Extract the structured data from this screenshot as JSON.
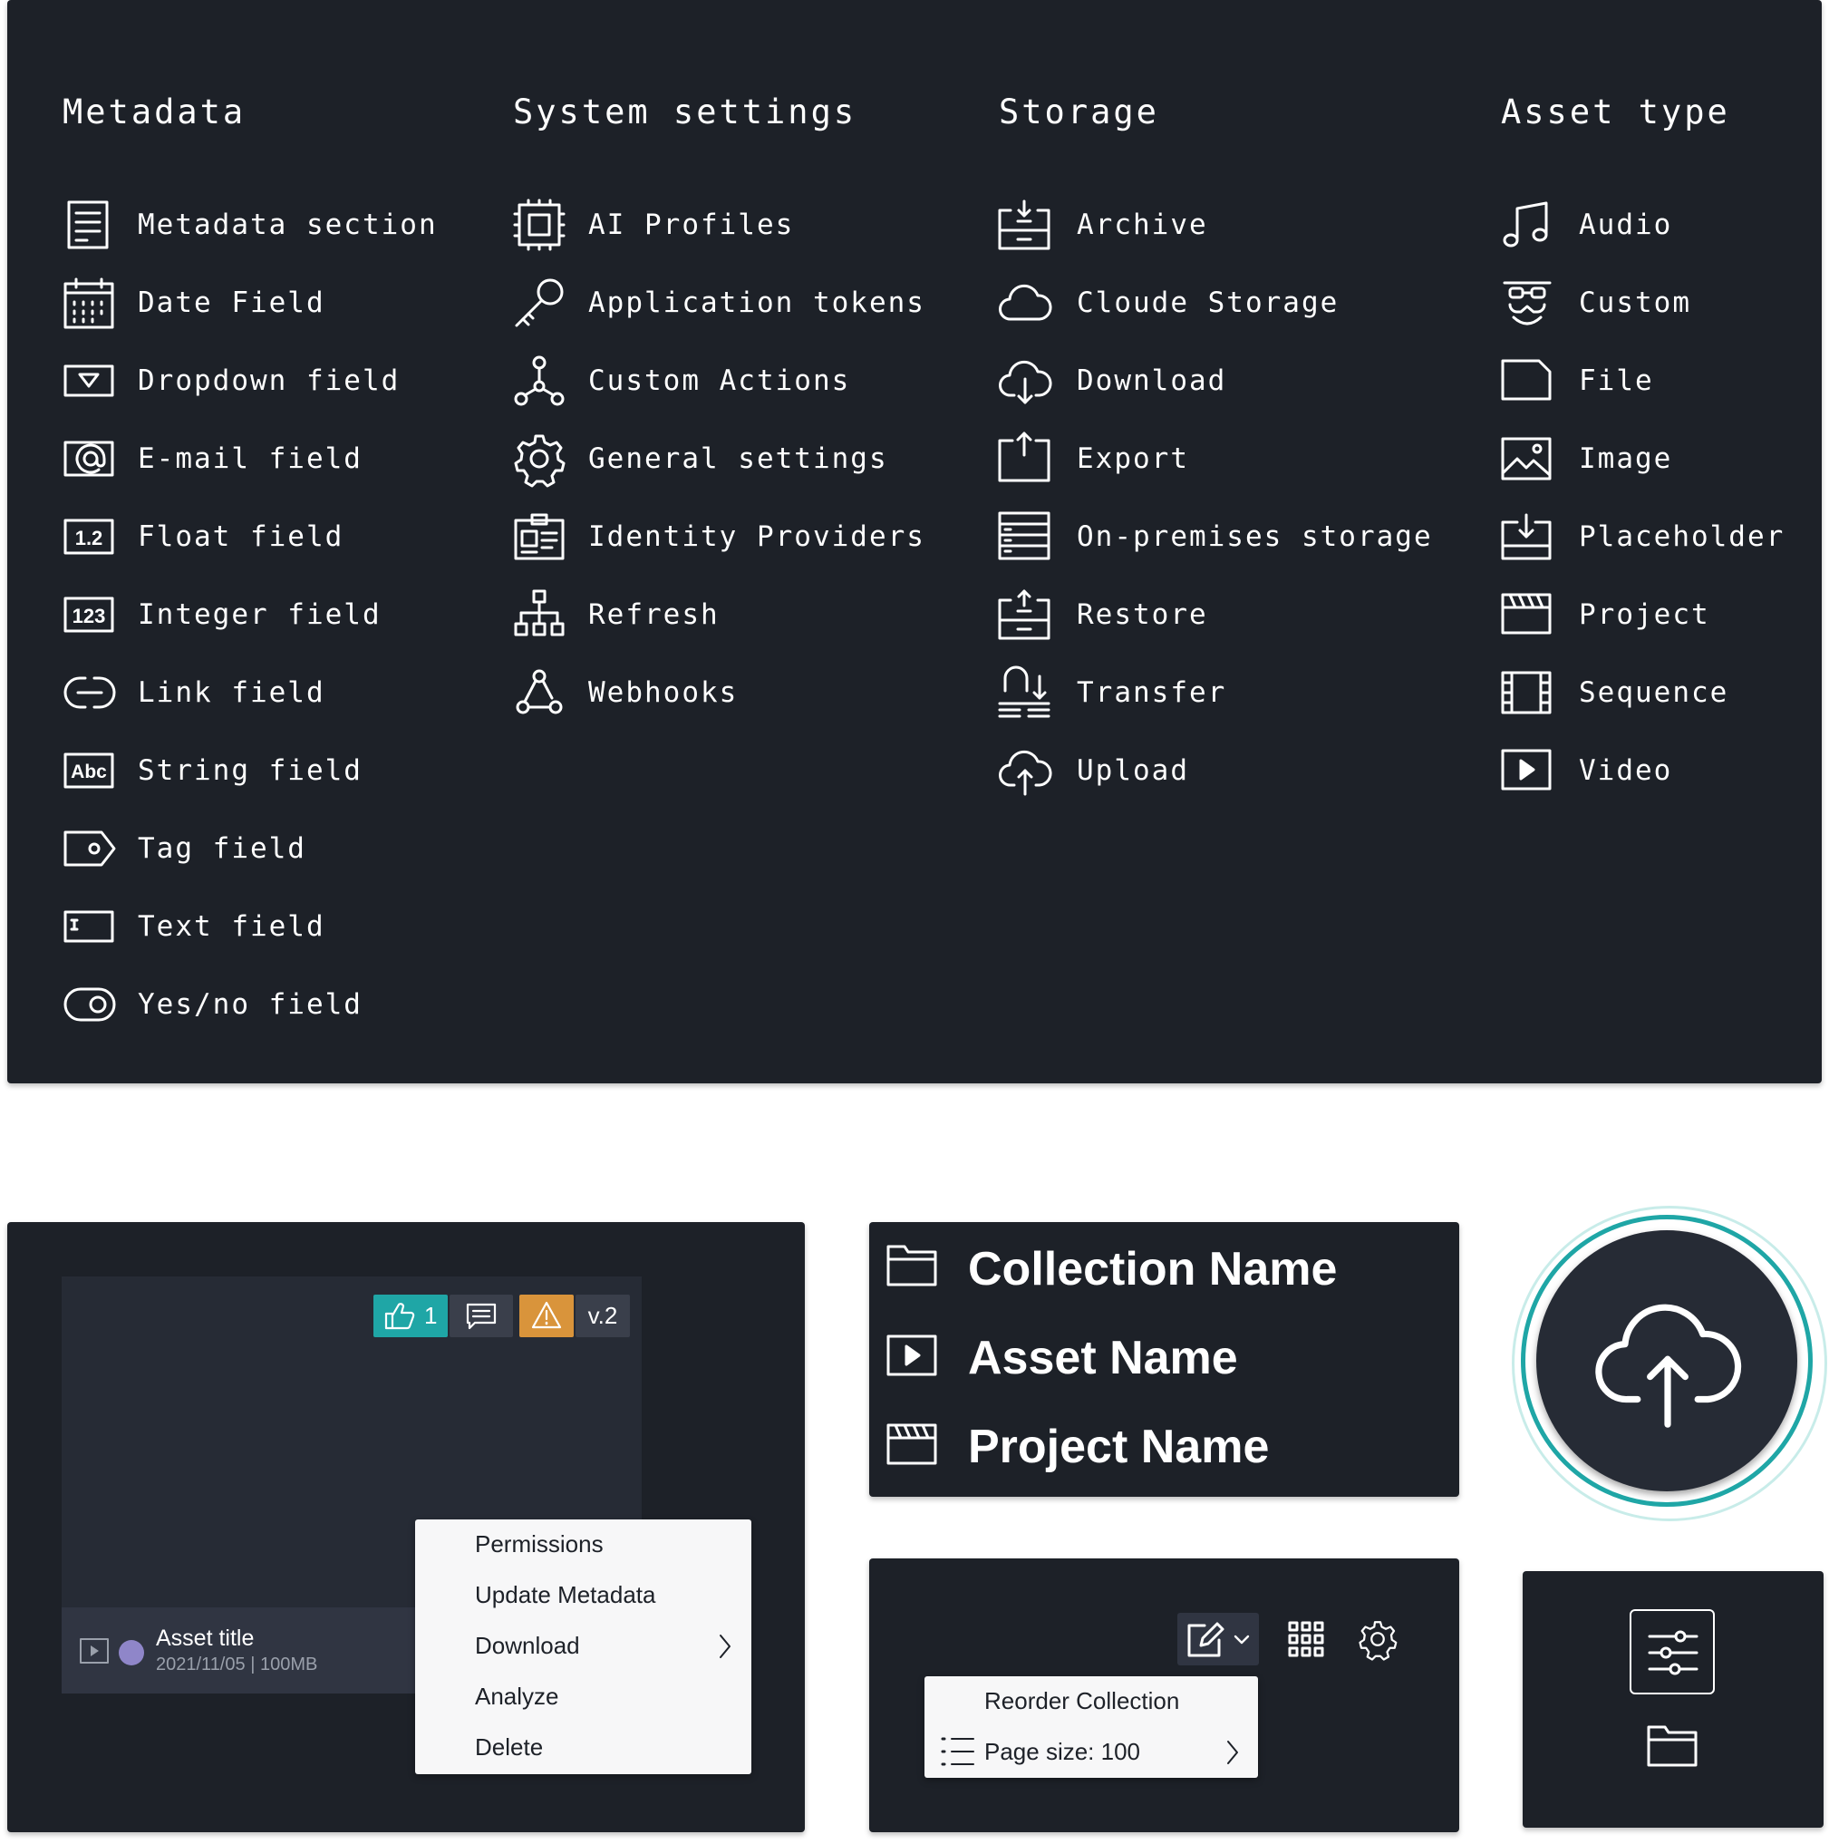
{
  "legend": {
    "columns": [
      {
        "title": "Metadata",
        "items": [
          {
            "label": "Metadata section",
            "icon": "metadata-section-icon"
          },
          {
            "label": "Date Field",
            "icon": "calendar-icon"
          },
          {
            "label": "Dropdown field",
            "icon": "dropdown-icon"
          },
          {
            "label": "E-mail field",
            "icon": "at-sign-icon"
          },
          {
            "label": "Float field",
            "icon": "float-icon"
          },
          {
            "label": "Integer field",
            "icon": "integer-icon"
          },
          {
            "label": "Link field",
            "icon": "link-icon"
          },
          {
            "label": "String field",
            "icon": "string-icon"
          },
          {
            "label": "Tag field",
            "icon": "tag-icon"
          },
          {
            "label": "Text field",
            "icon": "text-field-icon"
          },
          {
            "label": "Yes/no field",
            "icon": "toggle-icon"
          }
        ]
      },
      {
        "title": "System settings",
        "items": [
          {
            "label": "AI Profiles",
            "icon": "chip-icon"
          },
          {
            "label": "Application tokens",
            "icon": "key-icon"
          },
          {
            "label": "Custom Actions",
            "icon": "nodes-icon"
          },
          {
            "label": "General settings",
            "icon": "gear-icon"
          },
          {
            "label": "Identity Providers",
            "icon": "id-card-icon"
          },
          {
            "label": "Refresh",
            "icon": "hierarchy-icon"
          },
          {
            "label": "Webhooks",
            "icon": "webhook-icon"
          }
        ]
      },
      {
        "title": "Storage",
        "items": [
          {
            "label": "Archive",
            "icon": "archive-icon"
          },
          {
            "label": "Cloude Storage",
            "icon": "cloud-icon"
          },
          {
            "label": "Download",
            "icon": "cloud-download-icon"
          },
          {
            "label": "Export",
            "icon": "export-icon"
          },
          {
            "label": "On-premises storage",
            "icon": "server-icon"
          },
          {
            "label": "Restore",
            "icon": "restore-icon"
          },
          {
            "label": "Transfer",
            "icon": "transfer-icon"
          },
          {
            "label": "Upload",
            "icon": "cloud-upload-icon"
          }
        ]
      },
      {
        "title": "Asset type",
        "items": [
          {
            "label": "Audio",
            "icon": "music-note-icon"
          },
          {
            "label": "Custom",
            "icon": "disguise-icon"
          },
          {
            "label": "File",
            "icon": "file-icon"
          },
          {
            "label": "Image",
            "icon": "image-icon"
          },
          {
            "label": "Placeholder",
            "icon": "placeholder-icon"
          },
          {
            "label": "Project",
            "icon": "clapperboard-icon"
          },
          {
            "label": "Sequence",
            "icon": "film-strip-icon"
          },
          {
            "label": "Video",
            "icon": "video-icon"
          }
        ]
      }
    ]
  },
  "asset_card": {
    "likes": "1",
    "version": "v.2",
    "title": "Asset title",
    "date": "2021/11/05",
    "separator": "|",
    "size": "100MB",
    "context_menu": [
      "Permissions",
      "Update Metadata",
      "Download",
      "Analyze",
      "Delete"
    ],
    "colors": {
      "like": "#1fa6a6",
      "warning": "#d9943b",
      "panel": "#1d2128"
    }
  },
  "names": {
    "collection": "Collection Name",
    "asset": "Asset Name",
    "project": "Project Name"
  },
  "toolbar": {
    "menu": [
      "Reorder Collection",
      "Page size: 100"
    ]
  },
  "upload_button": {
    "icon": "cloud-upload-icon",
    "ring_color": "#1fa6a6"
  }
}
